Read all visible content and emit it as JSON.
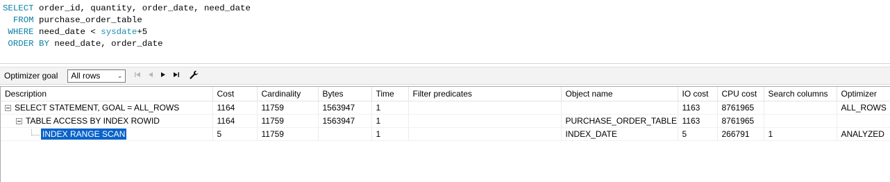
{
  "colors": {
    "keyword": "#0a7fa6",
    "function": "#1a8fb0",
    "selection": "#0a63c9"
  },
  "sql": {
    "line1": {
      "kw": "SELECT",
      "text": " order_id, quantity, order_date, need_date"
    },
    "line2": {
      "kw": "  FROM",
      "text": " purchase_order_table"
    },
    "line3": {
      "kw": " WHERE",
      "text": " need_date < ",
      "fn": "sysdate",
      "tail": "+5"
    },
    "line4": {
      "kw": " ORDER BY",
      "text": " need_date, order_date"
    }
  },
  "toolbar": {
    "goal_label": "Optimizer goal",
    "goal_value": "All rows",
    "first_icon": "first-record-icon",
    "prev_icon": "previous-icon",
    "next_icon": "next-icon",
    "last_icon": "last-record-icon",
    "settings_icon": "wrench-icon"
  },
  "plan": {
    "columns": [
      "Description",
      "Cost",
      "Cardinality",
      "Bytes",
      "Time",
      "Filter predicates",
      "Object name",
      "IO cost",
      "CPU cost",
      "Search columns",
      "Optimizer"
    ],
    "rows": [
      {
        "description": "SELECT STATEMENT, GOAL = ALL_ROWS",
        "cost": "1164",
        "cardinality": "11759",
        "bytes": "1563947",
        "time": "1",
        "filter": "",
        "object": "",
        "io_cost": "1163",
        "cpu_cost": "8761965",
        "search_columns": "",
        "optimizer": "ALL_ROWS"
      },
      {
        "description": "TABLE ACCESS BY INDEX ROWID",
        "cost": "1164",
        "cardinality": "11759",
        "bytes": "1563947",
        "time": "1",
        "filter": "",
        "object": "PURCHASE_ORDER_TABLE",
        "io_cost": "1163",
        "cpu_cost": "8761965",
        "search_columns": "",
        "optimizer": ""
      },
      {
        "description": "INDEX RANGE SCAN",
        "cost": "5",
        "cardinality": "11759",
        "bytes": "",
        "time": "1",
        "filter": "",
        "object": "INDEX_DATE",
        "io_cost": "5",
        "cpu_cost": "266791",
        "search_columns": "1",
        "optimizer": "ANALYZED"
      }
    ]
  }
}
